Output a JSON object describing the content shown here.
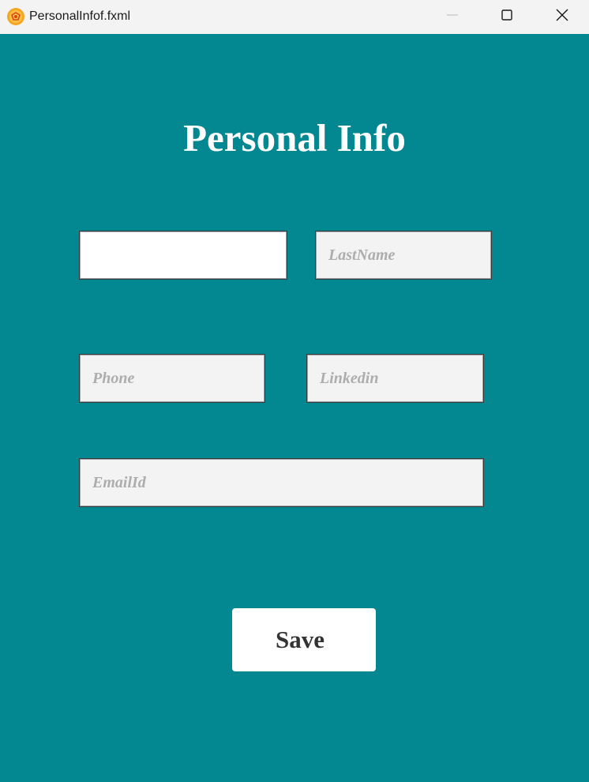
{
  "window": {
    "title": "PersonalInfof.fxml",
    "icon": "scene-builder-icon",
    "controls": [
      "minimize-icon",
      "maximize-icon",
      "close-icon"
    ]
  },
  "form": {
    "heading": "Personal Info",
    "fields": {
      "first_name": {
        "value": "",
        "placeholder": ""
      },
      "last_name": {
        "value": "",
        "placeholder": "LastName"
      },
      "phone": {
        "value": "",
        "placeholder": "Phone"
      },
      "linkedin": {
        "value": "",
        "placeholder": "Linkedin"
      },
      "email": {
        "value": "",
        "placeholder": "EmailId"
      }
    },
    "save_label": "Save"
  },
  "colors": {
    "background": "#038791",
    "titlebar": "#f3f3f3",
    "field_background": "#f3f3f3",
    "focused_field_background": "#ffffff",
    "placeholder": "#adadad",
    "heading_text": "#ffffff",
    "button_background": "#ffffff",
    "button_text": "#333333"
  }
}
